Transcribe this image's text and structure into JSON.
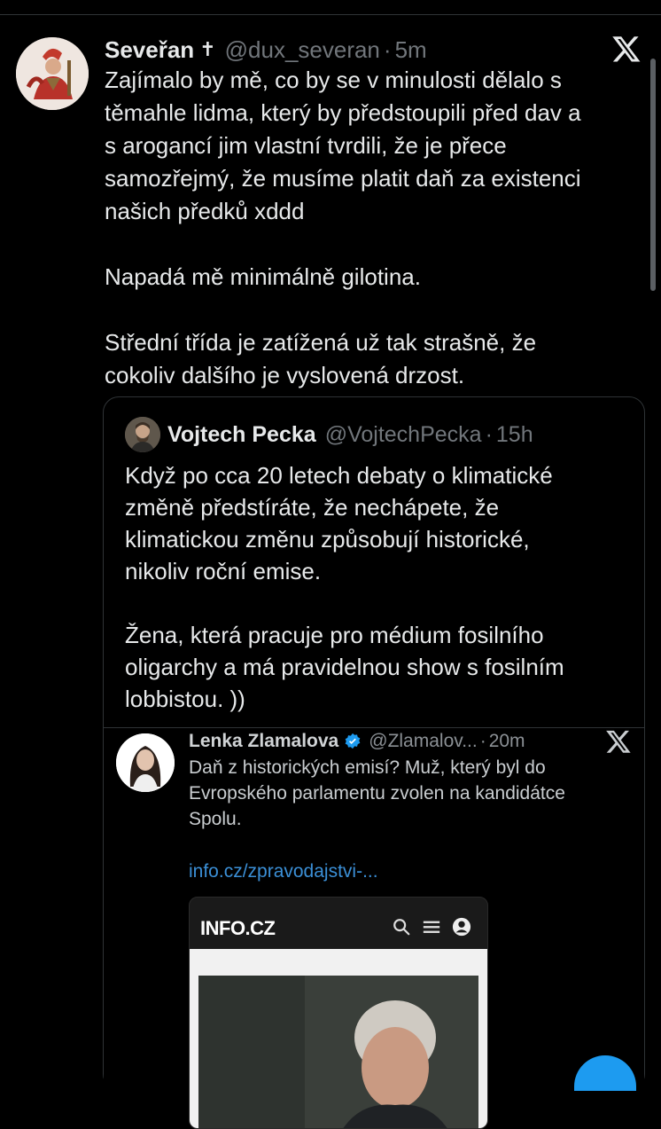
{
  "post": {
    "author_name": "Seveřan",
    "author_badge": "✝",
    "handle": "@dux_severan",
    "time": "5m",
    "paragraphs": [
      [
        "Zajímalo by mě, co by se v minulosti dělalo s",
        "těmahle lidma, který by předstoupili před dav a",
        "s arogancí jim vlastní tvrdili, že je přece",
        "samozřejmý, že musíme platit daň za existenci",
        "našich předků xddd"
      ],
      [
        "Napadá mě minimálně gilotina."
      ],
      [
        "Střední třída je zatížená už tak strašně, že",
        "cokoliv dalšího je vyslovená drzost."
      ]
    ]
  },
  "quote": {
    "author_name": "Vojtech Pecka",
    "handle": "@VojtechPecka",
    "time": "15h",
    "paragraphs": [
      [
        "Když po cca 20 letech debaty o klimatické",
        "změně předstíráte, že nechápete, že",
        "klimatickou změnu způsobují historické,",
        "nikoliv roční emise."
      ],
      [
        "Žena, která pracuje pro médium fosilního",
        "oligarchy a má pravidelnou show s fosilním",
        "lobbistou. ))"
      ]
    ]
  },
  "embedded": {
    "author_name": "Lenka Zlamalova",
    "handle": "@Zlamalov...",
    "time": "20m",
    "text_lines": [
      "Daň z historických emisí? Muž, který byl do",
      "Evropského parlamentu zvolen na kandidátce",
      "Spolu."
    ],
    "link": "info.cz/zpravodajstvi-...",
    "site_brand": "INFO.CZ"
  },
  "colors": {
    "background": "#000000",
    "text": "#e7e9ea",
    "muted": "#71767b",
    "link": "#3b8fd6",
    "verified": "#1d9bf0"
  },
  "icons": [
    "x-logo-icon",
    "verified-badge-icon",
    "search-icon",
    "menu-icon",
    "account-icon"
  ]
}
